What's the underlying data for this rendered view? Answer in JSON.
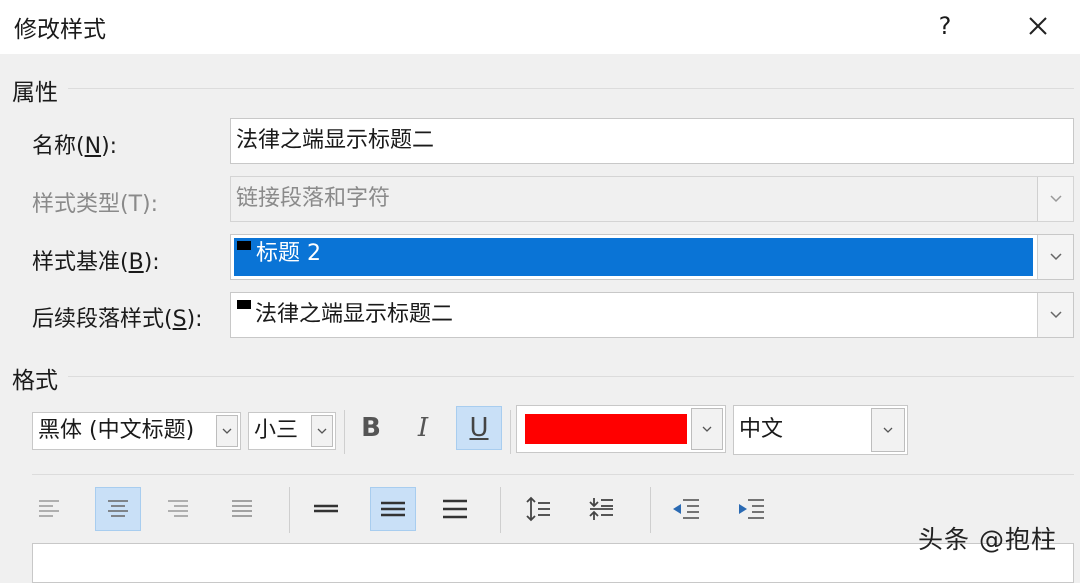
{
  "window": {
    "title": "修改样式",
    "help_label": "?"
  },
  "properties": {
    "section_title": "属性",
    "name_label_prefix": "名称(",
    "name_label_key": "N",
    "name_label_suffix": "):",
    "name_value": "法律之端显示标题二",
    "type_label": "样式类型(T):",
    "type_value": "链接段落和字符",
    "based_label_prefix": "样式基准(",
    "based_label_key": "B",
    "based_label_suffix": "):",
    "based_value": "标题 2",
    "next_label_prefix": "后续段落样式(",
    "next_label_key": "S",
    "next_label_suffix": "):",
    "next_value": "法律之端显示标题二"
  },
  "format": {
    "section_title": "格式",
    "font_value": "黑体 (中文标题)",
    "size_value": "小三",
    "bold_label": "B",
    "italic_label": "I",
    "underline_label": "U",
    "font_color": "#ff0000",
    "script_value": "中文"
  },
  "watermark": "头条 @抱柱"
}
